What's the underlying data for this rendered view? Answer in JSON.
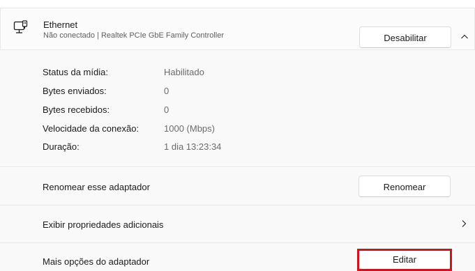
{
  "header": {
    "title": "Ethernet",
    "subtitle": "Não conectado | Realtek PCIe GbE Family Controller",
    "disable_label": "Desabilitar",
    "icon": "ethernet-adapter-icon",
    "expand_icon": "chevron-up-icon"
  },
  "details": {
    "media_status_label": "Status da mídia:",
    "media_status_value": "Habilitado",
    "bytes_sent_label": "Bytes enviados:",
    "bytes_sent_value": "0",
    "bytes_received_label": "Bytes recebidos:",
    "bytes_received_value": "0",
    "speed_label": "Velocidade da conexão:",
    "speed_value": "1000 (Mbps)",
    "duration_label": "Duração:",
    "duration_value": "1 dia 13:23:34"
  },
  "rename": {
    "label": "Renomear esse adaptador",
    "button": "Renomear"
  },
  "properties": {
    "label": "Exibir propriedades adicionais",
    "icon": "chevron-right-icon"
  },
  "more_options": {
    "label": "Mais opções do adaptador",
    "button": "Editar",
    "highlight_color": "#d3131a"
  }
}
